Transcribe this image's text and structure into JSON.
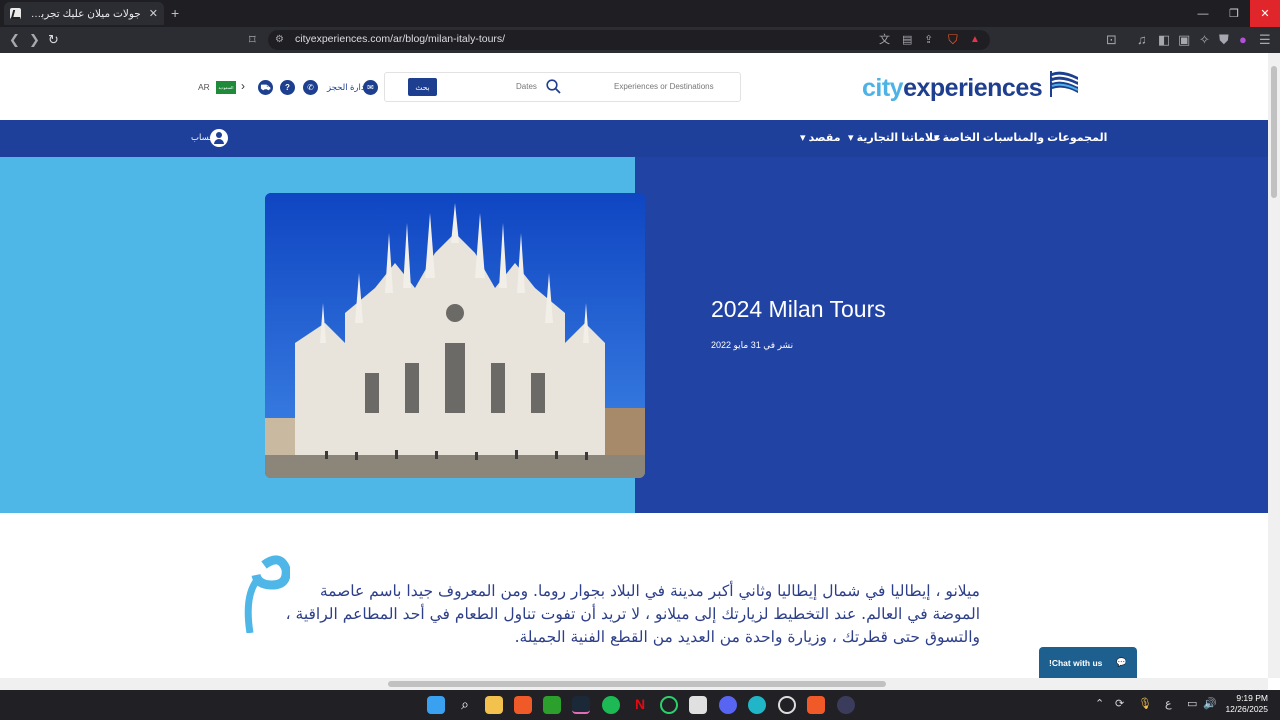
{
  "browser": {
    "tab_title": "جولات ميلان عليك تجربة | تجارب الم...",
    "tab_close": "✕",
    "new_tab": "+",
    "url": "cityexperiences.com/ar/blog/milan-italy-tours/",
    "window": {
      "minimize": "—",
      "restore": "❐",
      "close": "✕"
    }
  },
  "header": {
    "logo_part1": "city",
    "logo_part2": "experiences",
    "search_placeholder": "Experiences or Destinations",
    "dates_label": "Dates",
    "search_button": "بحث",
    "manage_booking": "إدارة الحجز",
    "language": "AR",
    "flag_text": "السعودية"
  },
  "nav": {
    "items": [
      {
        "label": "المجموعات والمناسبات الخاصة"
      },
      {
        "label": "علاماتنا التجارية"
      },
      {
        "label": "مقصد"
      }
    ],
    "account_label": "حساب"
  },
  "hero": {
    "title": "2024 Milan Tours",
    "published": "نشر في 31 مايو 2022"
  },
  "article": {
    "paragraph": "ميلانو ، إيطاليا في شمال إيطاليا وثاني أكبر مدينة في البلاد بجوار روما. ومن المعروف جيدا باسم عاصمة الموضة في العالم. عند التخطيط لزيارتك إلى ميلانو ، لا تريد أن تفوت تناول الطعام في أحد المطاعم الراقية ، والتسوق حتى قطرتك ، وزيارة واحدة من العديد من القطع الفنية الجميلة."
  },
  "chat": {
    "label": "!Chat with us"
  },
  "taskbar": {
    "time": "9:19 PM",
    "date": "12/26/2025",
    "input_lang": "ع"
  },
  "colors": {
    "brand_dark": "#1e3f9a",
    "brand_light": "#4fb6e8",
    "hero_right": "#2143a4"
  }
}
